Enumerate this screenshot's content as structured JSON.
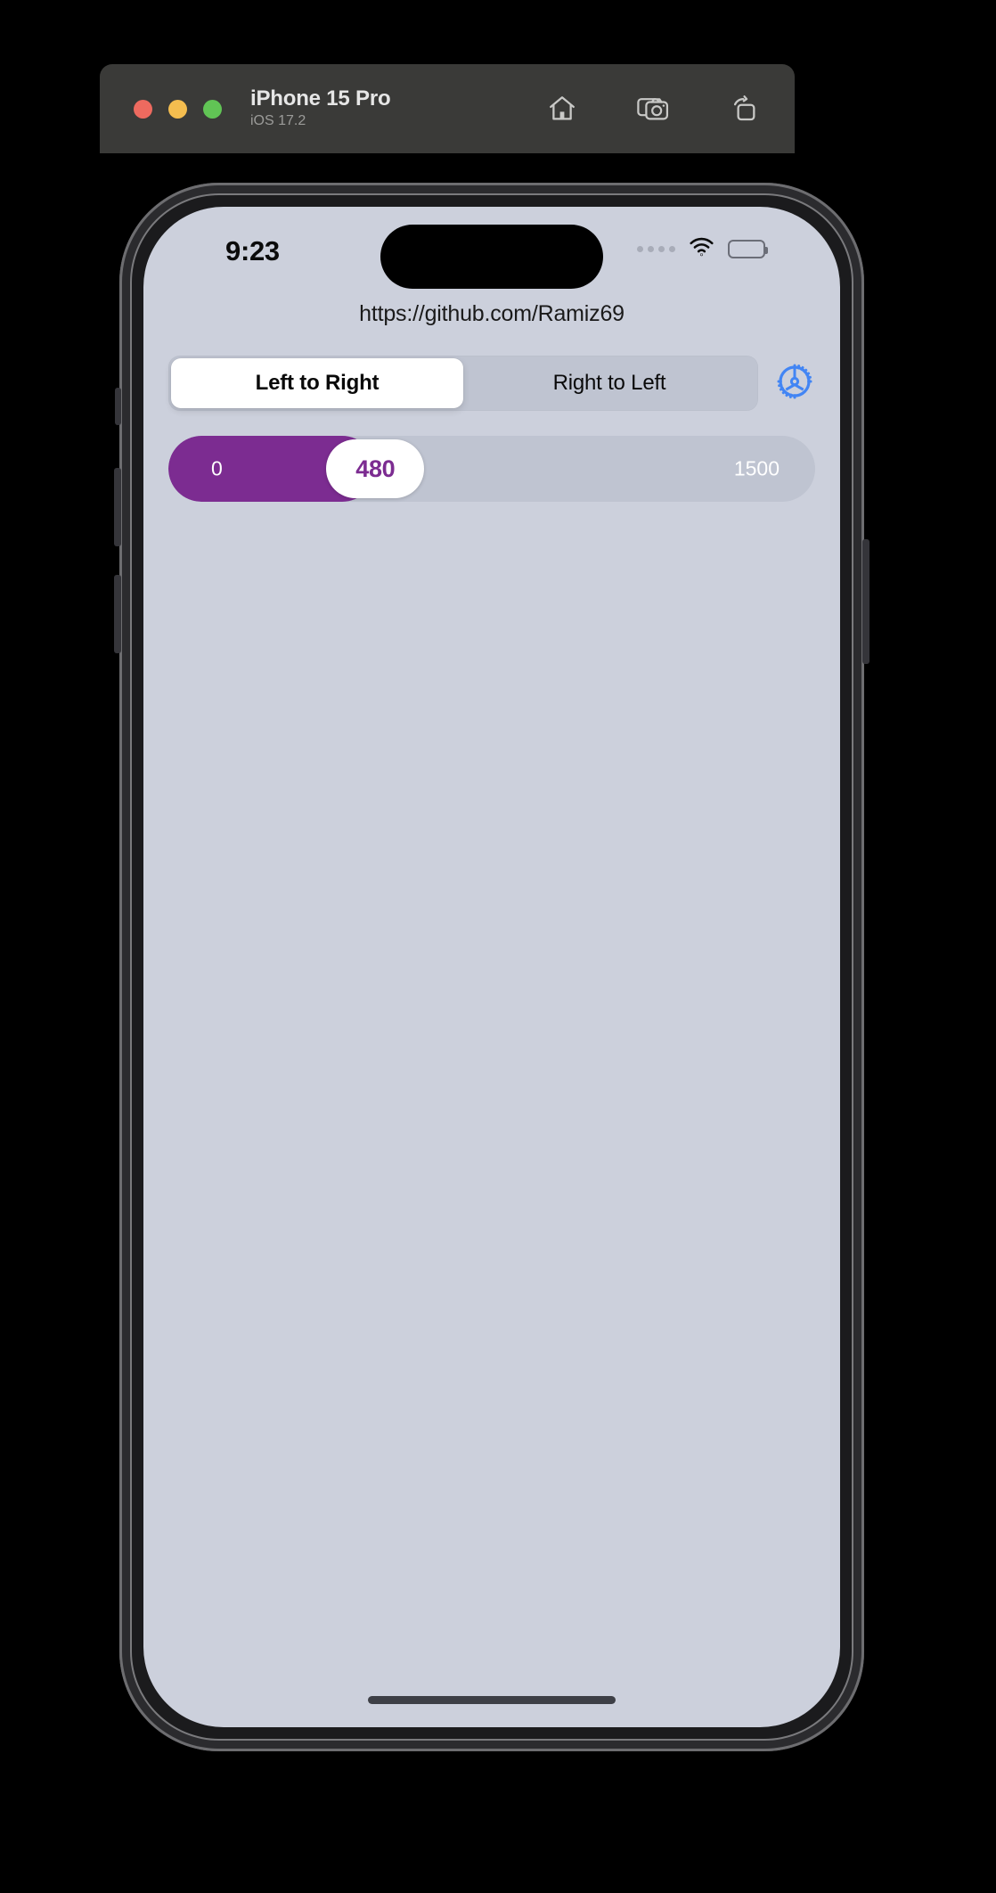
{
  "simulator": {
    "title": "iPhone 15 Pro",
    "subtitle": "iOS 17.2",
    "traffic_lights": [
      {
        "name": "close",
        "color": "#ed6a5f"
      },
      {
        "name": "minimize",
        "color": "#f4bd4f"
      },
      {
        "name": "zoom",
        "color": "#61c455"
      }
    ],
    "toolbar": [
      {
        "icon": "home-icon",
        "label": "Home"
      },
      {
        "icon": "screenshot-icon",
        "label": "Screenshot"
      },
      {
        "icon": "rotate-icon",
        "label": "Rotate"
      }
    ]
  },
  "status_bar": {
    "time": "9:23",
    "cellular_icon": "cellular-dots-icon",
    "wifi_icon": "wifi-icon",
    "battery_icon": "battery-icon"
  },
  "app": {
    "url_label": "https://github.com/Ramiz69",
    "segmented_control": {
      "options": [
        {
          "label": "Left to Right",
          "selected": true
        },
        {
          "label": "Right to Left",
          "selected": false
        }
      ]
    },
    "settings_icon": "gear-icon",
    "slider": {
      "min_label": "0",
      "max_label": "1500",
      "value_label": "480",
      "min": 0,
      "max": 1500,
      "value": 480,
      "fill_percent": 32,
      "fill_color": "#7c2c91",
      "track_color": "#bfc4d1",
      "thumb_color": "#ffffff"
    }
  },
  "colors": {
    "screen_background": "#ccd0dc",
    "accent_purple": "#7c2c91",
    "accent_blue": "#4285f4",
    "chrome_background": "#3a3a38"
  }
}
